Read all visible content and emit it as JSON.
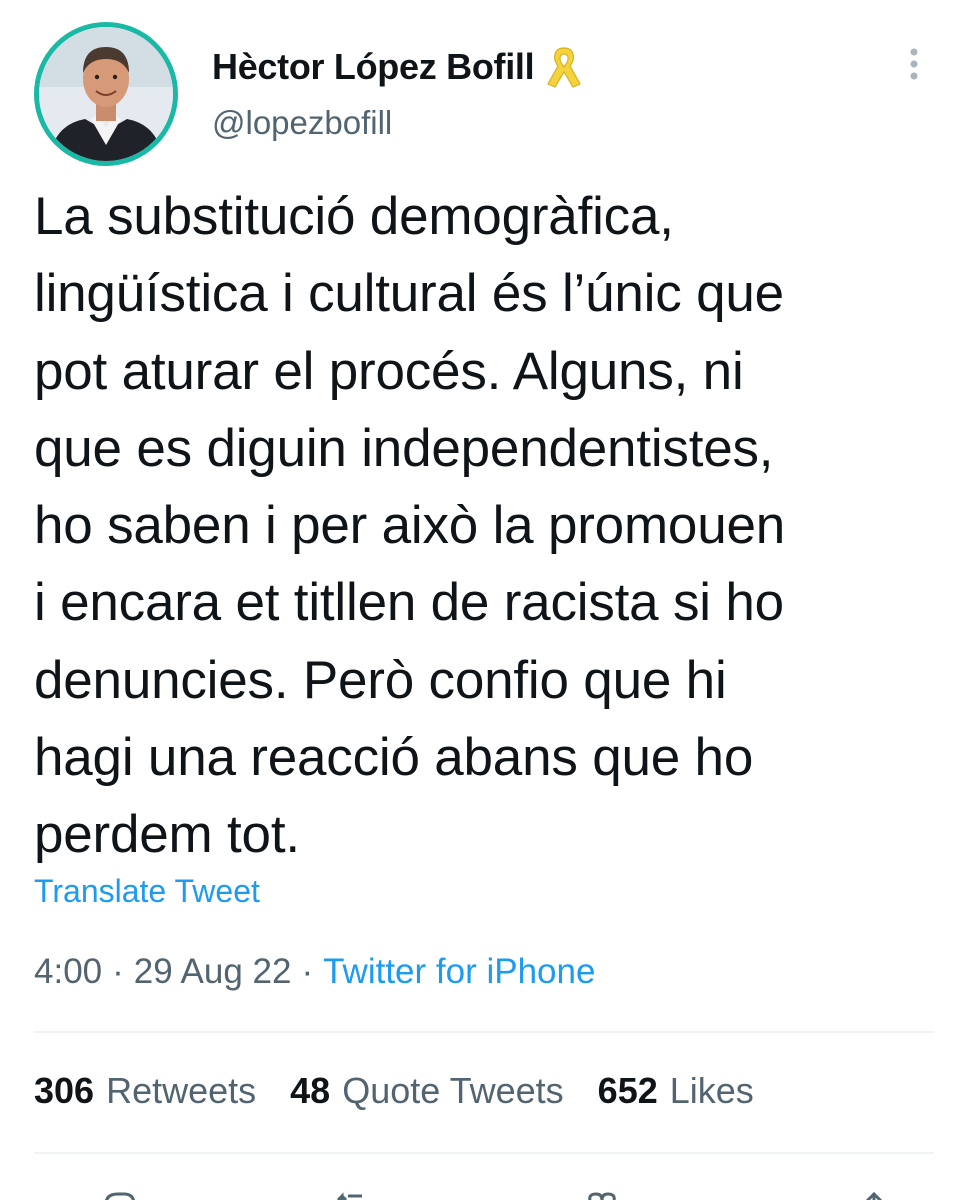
{
  "author": {
    "display_name": "Hèctor López Bofill",
    "handle": "@lopezbofill",
    "badge_icon": "yellow-ribbon-icon",
    "avatar_ring_color": "#19b9a6"
  },
  "tweet": {
    "text": "La substitució demogràfica,\nlingüística i cultural és l’únic que\npot aturar el procés. Alguns, ni\nque es diguin independentistes,\nho saben i per això la promouen\ni encara et titllen de racista si ho\ndenuncies. Però confio que hi\nhagi una reacció abans que ho\nperdem tot.",
    "translate_label": "Translate Tweet",
    "time": "4:00",
    "separator": "·",
    "date": "29 Aug 22",
    "source": "Twitter for iPhone"
  },
  "stats": {
    "retweets": {
      "count": "306",
      "label": "Retweets"
    },
    "quotes": {
      "count": "48",
      "label": "Quote Tweets"
    },
    "likes": {
      "count": "652",
      "label": "Likes"
    }
  },
  "actions": [
    "reply-icon",
    "retweet-icon",
    "like-icon",
    "share-icon"
  ],
  "colors": {
    "link": "#1d9bf0",
    "secondary_text": "#536471",
    "primary_text": "#0f1419",
    "ribbon": "#f5d33c"
  }
}
